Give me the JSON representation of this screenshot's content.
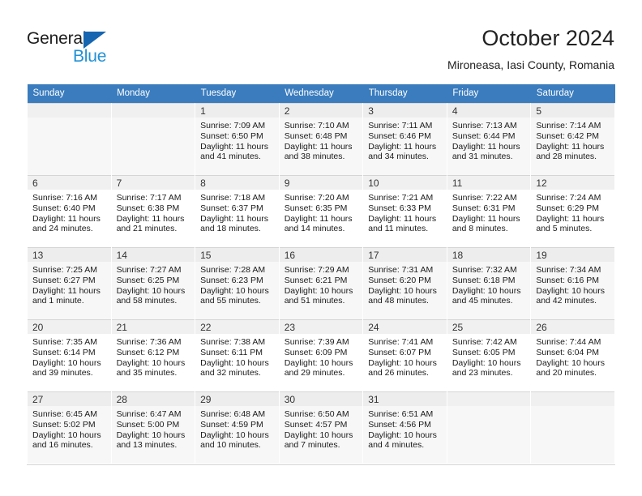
{
  "brand": {
    "name_part1": "General",
    "name_part2": "Blue",
    "triangle_icon": "triangle-icon",
    "color_dark": "#1d1d1d",
    "color_blue": "#2191d6",
    "color_triangle": "#1565b0"
  },
  "header": {
    "title": "October 2024",
    "subtitle": "Mironeasa, Iasi County, Romania"
  },
  "calendar": {
    "header_bg": "#3a7cbe",
    "weekdays": [
      "Sunday",
      "Monday",
      "Tuesday",
      "Wednesday",
      "Thursday",
      "Friday",
      "Saturday"
    ],
    "weeks": [
      [
        {
          "day": "",
          "empty": true,
          "sunrise": "",
          "sunset": "",
          "daylight1": "",
          "daylight2": ""
        },
        {
          "day": "",
          "empty": true,
          "sunrise": "",
          "sunset": "",
          "daylight1": "",
          "daylight2": ""
        },
        {
          "day": "1",
          "sunrise": "Sunrise: 7:09 AM",
          "sunset": "Sunset: 6:50 PM",
          "daylight1": "Daylight: 11 hours",
          "daylight2": "and 41 minutes."
        },
        {
          "day": "2",
          "sunrise": "Sunrise: 7:10 AM",
          "sunset": "Sunset: 6:48 PM",
          "daylight1": "Daylight: 11 hours",
          "daylight2": "and 38 minutes."
        },
        {
          "day": "3",
          "sunrise": "Sunrise: 7:11 AM",
          "sunset": "Sunset: 6:46 PM",
          "daylight1": "Daylight: 11 hours",
          "daylight2": "and 34 minutes."
        },
        {
          "day": "4",
          "sunrise": "Sunrise: 7:13 AM",
          "sunset": "Sunset: 6:44 PM",
          "daylight1": "Daylight: 11 hours",
          "daylight2": "and 31 minutes."
        },
        {
          "day": "5",
          "sunrise": "Sunrise: 7:14 AM",
          "sunset": "Sunset: 6:42 PM",
          "daylight1": "Daylight: 11 hours",
          "daylight2": "and 28 minutes."
        }
      ],
      [
        {
          "day": "6",
          "sunrise": "Sunrise: 7:16 AM",
          "sunset": "Sunset: 6:40 PM",
          "daylight1": "Daylight: 11 hours",
          "daylight2": "and 24 minutes."
        },
        {
          "day": "7",
          "sunrise": "Sunrise: 7:17 AM",
          "sunset": "Sunset: 6:38 PM",
          "daylight1": "Daylight: 11 hours",
          "daylight2": "and 21 minutes."
        },
        {
          "day": "8",
          "sunrise": "Sunrise: 7:18 AM",
          "sunset": "Sunset: 6:37 PM",
          "daylight1": "Daylight: 11 hours",
          "daylight2": "and 18 minutes."
        },
        {
          "day": "9",
          "sunrise": "Sunrise: 7:20 AM",
          "sunset": "Sunset: 6:35 PM",
          "daylight1": "Daylight: 11 hours",
          "daylight2": "and 14 minutes."
        },
        {
          "day": "10",
          "sunrise": "Sunrise: 7:21 AM",
          "sunset": "Sunset: 6:33 PM",
          "daylight1": "Daylight: 11 hours",
          "daylight2": "and 11 minutes."
        },
        {
          "day": "11",
          "sunrise": "Sunrise: 7:22 AM",
          "sunset": "Sunset: 6:31 PM",
          "daylight1": "Daylight: 11 hours",
          "daylight2": "and 8 minutes."
        },
        {
          "day": "12",
          "sunrise": "Sunrise: 7:24 AM",
          "sunset": "Sunset: 6:29 PM",
          "daylight1": "Daylight: 11 hours",
          "daylight2": "and 5 minutes."
        }
      ],
      [
        {
          "day": "13",
          "sunrise": "Sunrise: 7:25 AM",
          "sunset": "Sunset: 6:27 PM",
          "daylight1": "Daylight: 11 hours",
          "daylight2": "and 1 minute."
        },
        {
          "day": "14",
          "sunrise": "Sunrise: 7:27 AM",
          "sunset": "Sunset: 6:25 PM",
          "daylight1": "Daylight: 10 hours",
          "daylight2": "and 58 minutes."
        },
        {
          "day": "15",
          "sunrise": "Sunrise: 7:28 AM",
          "sunset": "Sunset: 6:23 PM",
          "daylight1": "Daylight: 10 hours",
          "daylight2": "and 55 minutes."
        },
        {
          "day": "16",
          "sunrise": "Sunrise: 7:29 AM",
          "sunset": "Sunset: 6:21 PM",
          "daylight1": "Daylight: 10 hours",
          "daylight2": "and 51 minutes."
        },
        {
          "day": "17",
          "sunrise": "Sunrise: 7:31 AM",
          "sunset": "Sunset: 6:20 PM",
          "daylight1": "Daylight: 10 hours",
          "daylight2": "and 48 minutes."
        },
        {
          "day": "18",
          "sunrise": "Sunrise: 7:32 AM",
          "sunset": "Sunset: 6:18 PM",
          "daylight1": "Daylight: 10 hours",
          "daylight2": "and 45 minutes."
        },
        {
          "day": "19",
          "sunrise": "Sunrise: 7:34 AM",
          "sunset": "Sunset: 6:16 PM",
          "daylight1": "Daylight: 10 hours",
          "daylight2": "and 42 minutes."
        }
      ],
      [
        {
          "day": "20",
          "sunrise": "Sunrise: 7:35 AM",
          "sunset": "Sunset: 6:14 PM",
          "daylight1": "Daylight: 10 hours",
          "daylight2": "and 39 minutes."
        },
        {
          "day": "21",
          "sunrise": "Sunrise: 7:36 AM",
          "sunset": "Sunset: 6:12 PM",
          "daylight1": "Daylight: 10 hours",
          "daylight2": "and 35 minutes."
        },
        {
          "day": "22",
          "sunrise": "Sunrise: 7:38 AM",
          "sunset": "Sunset: 6:11 PM",
          "daylight1": "Daylight: 10 hours",
          "daylight2": "and 32 minutes."
        },
        {
          "day": "23",
          "sunrise": "Sunrise: 7:39 AM",
          "sunset": "Sunset: 6:09 PM",
          "daylight1": "Daylight: 10 hours",
          "daylight2": "and 29 minutes."
        },
        {
          "day": "24",
          "sunrise": "Sunrise: 7:41 AM",
          "sunset": "Sunset: 6:07 PM",
          "daylight1": "Daylight: 10 hours",
          "daylight2": "and 26 minutes."
        },
        {
          "day": "25",
          "sunrise": "Sunrise: 7:42 AM",
          "sunset": "Sunset: 6:05 PM",
          "daylight1": "Daylight: 10 hours",
          "daylight2": "and 23 minutes."
        },
        {
          "day": "26",
          "sunrise": "Sunrise: 7:44 AM",
          "sunset": "Sunset: 6:04 PM",
          "daylight1": "Daylight: 10 hours",
          "daylight2": "and 20 minutes."
        }
      ],
      [
        {
          "day": "27",
          "sunrise": "Sunrise: 6:45 AM",
          "sunset": "Sunset: 5:02 PM",
          "daylight1": "Daylight: 10 hours",
          "daylight2": "and 16 minutes."
        },
        {
          "day": "28",
          "sunrise": "Sunrise: 6:47 AM",
          "sunset": "Sunset: 5:00 PM",
          "daylight1": "Daylight: 10 hours",
          "daylight2": "and 13 minutes."
        },
        {
          "day": "29",
          "sunrise": "Sunrise: 6:48 AM",
          "sunset": "Sunset: 4:59 PM",
          "daylight1": "Daylight: 10 hours",
          "daylight2": "and 10 minutes."
        },
        {
          "day": "30",
          "sunrise": "Sunrise: 6:50 AM",
          "sunset": "Sunset: 4:57 PM",
          "daylight1": "Daylight: 10 hours",
          "daylight2": "and 7 minutes."
        },
        {
          "day": "31",
          "sunrise": "Sunrise: 6:51 AM",
          "sunset": "Sunset: 4:56 PM",
          "daylight1": "Daylight: 10 hours",
          "daylight2": "and 4 minutes."
        },
        {
          "day": "",
          "empty": true,
          "sunrise": "",
          "sunset": "",
          "daylight1": "",
          "daylight2": ""
        },
        {
          "day": "",
          "empty": true,
          "sunrise": "",
          "sunset": "",
          "daylight1": "",
          "daylight2": ""
        }
      ]
    ]
  }
}
